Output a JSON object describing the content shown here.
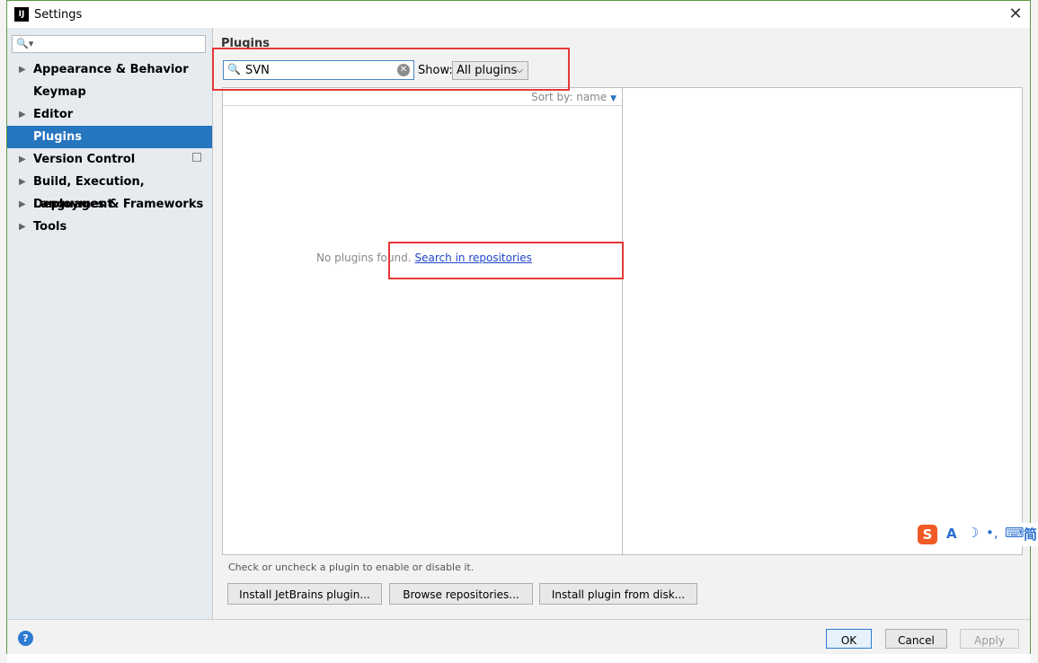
{
  "window": {
    "title": "Settings",
    "app_icon": "IJ"
  },
  "sidebar": {
    "search_placeholder": "",
    "items": [
      {
        "label": "Appearance & Behavior",
        "expandable": true
      },
      {
        "label": "Keymap",
        "expandable": false
      },
      {
        "label": "Editor",
        "expandable": true
      },
      {
        "label": "Plugins",
        "expandable": false,
        "selected": true
      },
      {
        "label": "Version Control",
        "expandable": true
      },
      {
        "label": "Build, Execution, Deployment",
        "expandable": true
      },
      {
        "label": "Languages & Frameworks",
        "expandable": true
      },
      {
        "label": "Tools",
        "expandable": true
      }
    ]
  },
  "plugins": {
    "title": "Plugins",
    "search_value": "SVN",
    "show_label": "Show:",
    "show_selected": "All plugins",
    "sort_label": "Sort by: name",
    "empty_message": "No plugins found.",
    "search_link": "Search in repositories",
    "hint": "Check or uncheck a plugin to enable or disable it.",
    "buttons": {
      "install_jetbrains": "Install JetBrains plugin...",
      "browse": "Browse repositories...",
      "install_disk": "Install plugin from disk..."
    }
  },
  "footer": {
    "ok": "OK",
    "cancel": "Cancel",
    "apply": "Apply",
    "help": "?"
  },
  "ime": {
    "s": "S",
    "a": "A",
    "moon": "☽",
    "dot": "•,",
    "keyboard": "⌨",
    "jian": "简"
  },
  "colors": {
    "selection": "#2675bf",
    "link": "#2045c9",
    "annotation": "#e53935",
    "dialog_border": "#5d9b41"
  }
}
